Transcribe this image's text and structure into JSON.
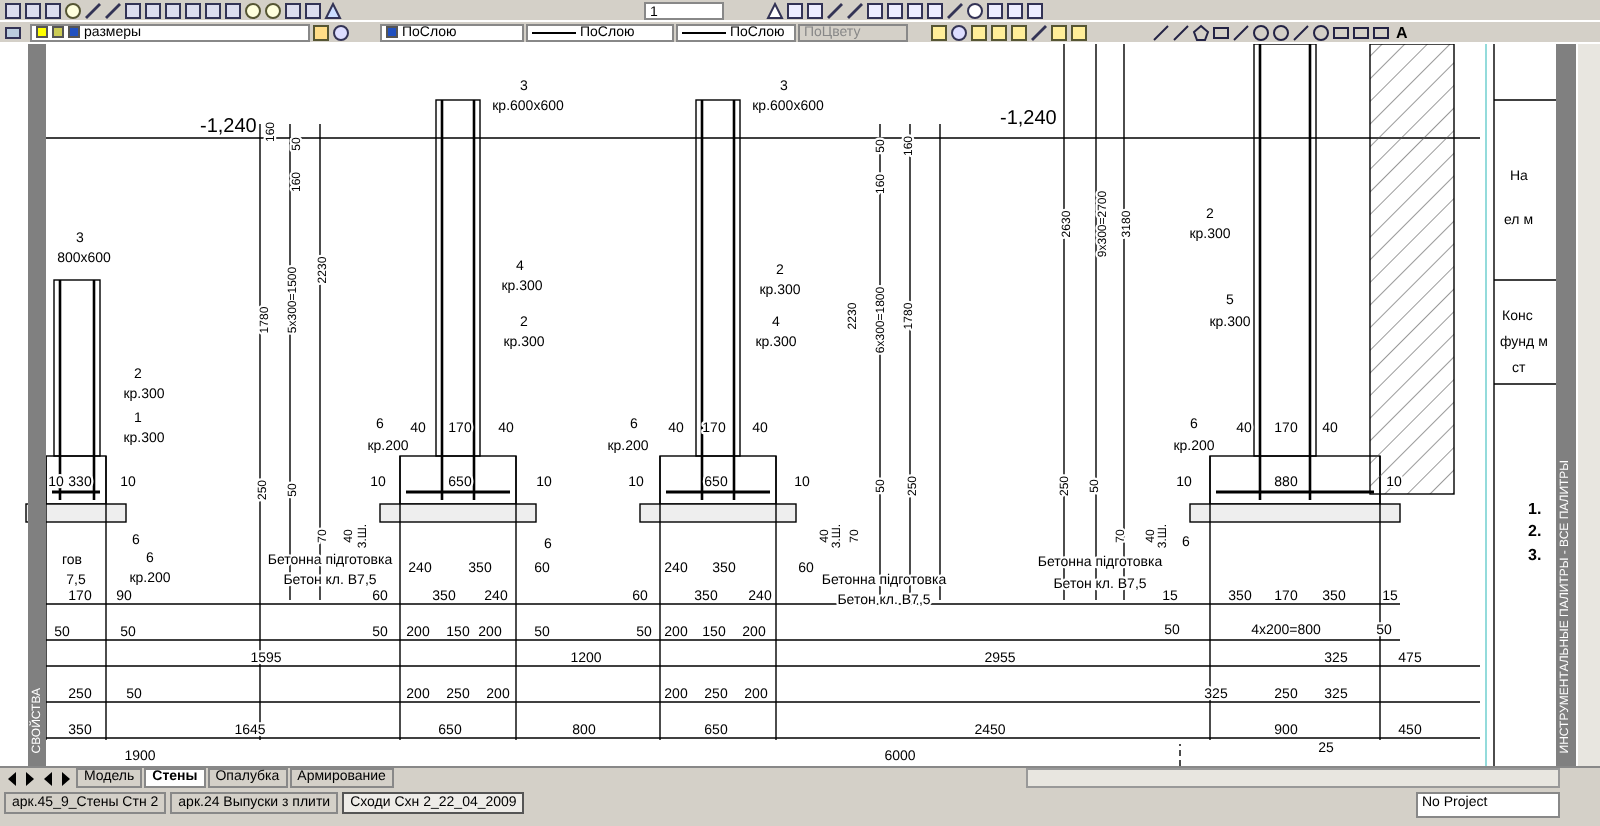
{
  "toolbar": {
    "text_field": "1",
    "layer": "размеры",
    "color_dropdown": "ПоСлою",
    "linetype": "ПоСлою",
    "lineweight": "ПоСлою",
    "plotstyle": {
      "value": "ПоЦвету",
      "disabled": true
    },
    "text_tool": "A"
  },
  "drawing": {
    "labels": [
      {
        "text": "-1,240",
        "kind": "level"
      },
      {
        "text": "-1,240",
        "kind": "level"
      },
      {
        "text": "3",
        "kind": "note"
      },
      {
        "text": "кр.600х600",
        "kind": "note"
      },
      {
        "text": "3",
        "kind": "note"
      },
      {
        "text": "кр.600х600",
        "kind": "note"
      },
      {
        "text": "3",
        "kind": "note"
      },
      {
        "text": "800х600",
        "kind": "note"
      },
      {
        "text": "4",
        "kind": "note"
      },
      {
        "text": "кр.300",
        "kind": "note"
      },
      {
        "text": "2",
        "kind": "note"
      },
      {
        "text": "кр.300",
        "kind": "note"
      },
      {
        "text": "2",
        "kind": "note"
      },
      {
        "text": "кр.300",
        "kind": "note"
      },
      {
        "text": "4",
        "kind": "note"
      },
      {
        "text": "кр.300",
        "kind": "note"
      },
      {
        "text": "2",
        "kind": "note"
      },
      {
        "text": "кр.300",
        "kind": "note"
      },
      {
        "text": "1",
        "kind": "note"
      },
      {
        "text": "кр.300",
        "kind": "note"
      },
      {
        "text": "2",
        "kind": "note"
      },
      {
        "text": "кр.300",
        "kind": "note"
      },
      {
        "text": "5",
        "kind": "note"
      },
      {
        "text": "кр.300",
        "kind": "note"
      },
      {
        "text": "160",
        "kind": "vdim"
      },
      {
        "text": "50",
        "kind": "vdim"
      },
      {
        "text": "160",
        "kind": "vdim"
      },
      {
        "text": "1780",
        "kind": "vdim"
      },
      {
        "text": "5х300=1500",
        "kind": "vdim"
      },
      {
        "text": "2230",
        "kind": "vdim"
      },
      {
        "text": "50",
        "kind": "vdim"
      },
      {
        "text": "160",
        "kind": "vdim"
      },
      {
        "text": "160",
        "kind": "vdim"
      },
      {
        "text": "2230",
        "kind": "vdim"
      },
      {
        "text": "6х300=1800",
        "kind": "vdim"
      },
      {
        "text": "1780",
        "kind": "vdim"
      },
      {
        "text": "2630",
        "kind": "vdim"
      },
      {
        "text": "9х300=2700",
        "kind": "vdim"
      },
      {
        "text": "3180",
        "kind": "vdim"
      },
      {
        "text": "250",
        "kind": "vdim"
      },
      {
        "text": "50",
        "kind": "vdim"
      },
      {
        "text": "70",
        "kind": "vdim"
      },
      {
        "text": "40",
        "kind": "vdim"
      },
      {
        "text": "3.Ш.",
        "kind": "vdim"
      },
      {
        "text": "50",
        "kind": "vdim"
      },
      {
        "text": "250",
        "kind": "vdim"
      },
      {
        "text": "40",
        "kind": "vdim"
      },
      {
        "text": "3.Ш.",
        "kind": "vdim"
      },
      {
        "text": "70",
        "kind": "vdim"
      },
      {
        "text": "250",
        "kind": "vdim"
      },
      {
        "text": "50",
        "kind": "vdim"
      },
      {
        "text": "70",
        "kind": "vdim"
      },
      {
        "text": "40",
        "kind": "vdim"
      },
      {
        "text": "3.Ш.",
        "kind": "vdim"
      },
      {
        "text": "6",
        "kind": "note"
      },
      {
        "text": "кр.200",
        "kind": "note"
      },
      {
        "text": "40",
        "kind": "dim"
      },
      {
        "text": "170",
        "kind": "dim"
      },
      {
        "text": "40",
        "kind": "dim"
      },
      {
        "text": "10",
        "kind": "dim"
      },
      {
        "text": "650",
        "kind": "dim"
      },
      {
        "text": "10",
        "kind": "dim"
      },
      {
        "text": "6",
        "kind": "note"
      },
      {
        "text": "240",
        "kind": "dim"
      },
      {
        "text": "350",
        "kind": "dim"
      },
      {
        "text": "60",
        "kind": "dim"
      },
      {
        "text": "60",
        "kind": "dim"
      },
      {
        "text": "350",
        "kind": "dim"
      },
      {
        "text": "240",
        "kind": "dim"
      },
      {
        "text": "50",
        "kind": "dim"
      },
      {
        "text": "200",
        "kind": "dim"
      },
      {
        "text": "150",
        "kind": "dim"
      },
      {
        "text": "200",
        "kind": "dim"
      },
      {
        "text": "50",
        "kind": "dim"
      },
      {
        "text": "200",
        "kind": "dim"
      },
      {
        "text": "250",
        "kind": "dim"
      },
      {
        "text": "200",
        "kind": "dim"
      },
      {
        "text": "650",
        "kind": "dim"
      },
      {
        "text": "6",
        "kind": "note"
      },
      {
        "text": "кр.200",
        "kind": "note"
      },
      {
        "text": "40",
        "kind": "dim"
      },
      {
        "text": "170",
        "kind": "dim"
      },
      {
        "text": "40",
        "kind": "dim"
      },
      {
        "text": "10",
        "kind": "dim"
      },
      {
        "text": "650",
        "kind": "dim"
      },
      {
        "text": "10",
        "kind": "dim"
      },
      {
        "text": "240",
        "kind": "dim"
      },
      {
        "text": "350",
        "kind": "dim"
      },
      {
        "text": "60",
        "kind": "dim"
      },
      {
        "text": "60",
        "kind": "dim"
      },
      {
        "text": "350",
        "kind": "dim"
      },
      {
        "text": "240",
        "kind": "dim"
      },
      {
        "text": "50",
        "kind": "dim"
      },
      {
        "text": "200",
        "kind": "dim"
      },
      {
        "text": "150",
        "kind": "dim"
      },
      {
        "text": "200",
        "kind": "dim"
      },
      {
        "text": "200",
        "kind": "dim"
      },
      {
        "text": "250",
        "kind": "dim"
      },
      {
        "text": "200",
        "kind": "dim"
      },
      {
        "text": "650",
        "kind": "dim"
      },
      {
        "text": "6",
        "kind": "note"
      },
      {
        "text": "кр.200",
        "kind": "note"
      },
      {
        "text": "40",
        "kind": "dim"
      },
      {
        "text": "170",
        "kind": "dim"
      },
      {
        "text": "40",
        "kind": "dim"
      },
      {
        "text": "10",
        "kind": "dim"
      },
      {
        "text": "880",
        "kind": "dim"
      },
      {
        "text": "10",
        "kind": "dim"
      },
      {
        "text": "6",
        "kind": "note"
      },
      {
        "text": "15",
        "kind": "dim"
      },
      {
        "text": "350",
        "kind": "dim"
      },
      {
        "text": "170",
        "kind": "dim"
      },
      {
        "text": "350",
        "kind": "dim"
      },
      {
        "text": "15",
        "kind": "dim"
      },
      {
        "text": "50",
        "kind": "dim"
      },
      {
        "text": "4х200=800",
        "kind": "dim"
      },
      {
        "text": "50",
        "kind": "dim"
      },
      {
        "text": "325",
        "kind": "dim"
      },
      {
        "text": "475",
        "kind": "dim"
      },
      {
        "text": "325",
        "kind": "dim"
      },
      {
        "text": "250",
        "kind": "dim"
      },
      {
        "text": "325",
        "kind": "dim"
      },
      {
        "text": "10",
        "kind": "dim"
      },
      {
        "text": "330",
        "kind": "dim"
      },
      {
        "text": "10",
        "kind": "dim"
      },
      {
        "text": "6",
        "kind": "note"
      },
      {
        "text": "6",
        "kind": "note"
      },
      {
        "text": "кр.200",
        "kind": "note"
      },
      {
        "text": "170",
        "kind": "dim"
      },
      {
        "text": "90",
        "kind": "dim"
      },
      {
        "text": "50",
        "kind": "dim"
      },
      {
        "text": "50",
        "kind": "dim"
      },
      {
        "text": "250",
        "kind": "dim"
      },
      {
        "text": "50",
        "kind": "dim"
      },
      {
        "text": "350",
        "kind": "dim"
      },
      {
        "text": "1595",
        "kind": "dim"
      },
      {
        "text": "1200",
        "kind": "dim"
      },
      {
        "text": "2955",
        "kind": "dim"
      },
      {
        "text": "1645",
        "kind": "dim"
      },
      {
        "text": "800",
        "kind": "dim"
      },
      {
        "text": "2450",
        "kind": "dim"
      },
      {
        "text": "900",
        "kind": "dim"
      },
      {
        "text": "450",
        "kind": "dim"
      },
      {
        "text": "1900",
        "kind": "dim"
      },
      {
        "text": "6000",
        "kind": "dim"
      },
      {
        "text": "25",
        "kind": "dim"
      },
      {
        "text": "Бетонна підготовка",
        "kind": "note"
      },
      {
        "text": "Бетон кл. В7,5",
        "kind": "note"
      },
      {
        "text": "Бетонна підготовка",
        "kind": "note"
      },
      {
        "text": "Бетон кл. В7,5",
        "kind": "note"
      },
      {
        "text": "Бетонна підготовка",
        "kind": "note"
      },
      {
        "text": "Бетон кл. В7,5",
        "kind": "note"
      },
      {
        "text": "гов",
        "kind": "note"
      },
      {
        "text": "7,5",
        "kind": "note"
      }
    ],
    "title_block": [
      "На",
      "ел м",
      "Конс",
      "фунд м",
      "ст",
      "1.",
      "2.",
      "3."
    ]
  },
  "palettes": {
    "left": "СВОЙСТВА",
    "right": "ИНСТРУМЕНТАЛЬНЫЕ ПАЛИТРЫ - ВСЕ ПАЛИТРЫ"
  },
  "layout_tabs": [
    {
      "label": "Модель",
      "selected": false
    },
    {
      "label": "Стены",
      "selected": true
    },
    {
      "label": "Опалубка",
      "selected": false
    },
    {
      "label": "Армирование",
      "selected": false
    }
  ],
  "taskbar": {
    "documents": [
      {
        "label": "арк.45_9_Стены Стн 2",
        "selected": false
      },
      {
        "label": "арк.24 Выпуски з плити",
        "selected": false
      },
      {
        "label": "Сходи Схн 2_22_04_2009",
        "selected": true
      }
    ],
    "project": "No Project"
  }
}
